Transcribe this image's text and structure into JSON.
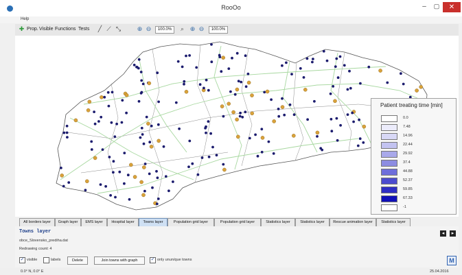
{
  "window": {
    "title": "RooOo"
  },
  "menu": {
    "help": "Help"
  },
  "toolbar": {
    "prop": "Prop.",
    "visible": "Visible",
    "functions": "Functions",
    "tests": "Tests",
    "zoom1": "100.0%",
    "zoom2": "100.0%"
  },
  "legend": {
    "title": "Patient treating time [min]",
    "items": [
      {
        "label": "0.0",
        "color": "#ffffff"
      },
      {
        "label": "7.48",
        "color": "#ececfb"
      },
      {
        "label": "14.96",
        "color": "#d8d8f6"
      },
      {
        "label": "22.44",
        "color": "#c3c3f1"
      },
      {
        "label": "29.92",
        "color": "#a9a9ea"
      },
      {
        "label": "37.4",
        "color": "#8d8de2"
      },
      {
        "label": "44.88",
        "color": "#6e6edb"
      },
      {
        "label": "52.37",
        "color": "#4c4ccf"
      },
      {
        "label": "59.85",
        "color": "#2e2ec4"
      },
      {
        "label": "67.33",
        "color": "#1010b8"
      },
      {
        "label": "-1",
        "color": "#ffffff"
      }
    ]
  },
  "tabs": [
    {
      "label": "All borders layer",
      "active": false
    },
    {
      "label": "Graph layer",
      "active": false
    },
    {
      "label": "EMS layer",
      "active": false
    },
    {
      "label": "Hospital layer",
      "active": false
    },
    {
      "label": "Towns layer",
      "active": true
    },
    {
      "label": "Population grid layer",
      "active": false
    },
    {
      "label": "Population grid layer",
      "active": false
    },
    {
      "label": "Statistics layer",
      "active": false
    },
    {
      "label": "Statistics layer",
      "active": false
    },
    {
      "label": "Rescue animation layer",
      "active": false
    },
    {
      "label": "Statistics layer",
      "active": false
    }
  ],
  "panel": {
    "title": "Towns layer",
    "file": "obce_Slovensko_prediha.dat",
    "redrawing": "Redrawing count: 4",
    "visible_label": "visible",
    "visible_checked": true,
    "labels_label": "labels",
    "labels_checked": false,
    "delete_label": "Delete",
    "join_label": "Join towns with graph",
    "unique_label": "only unun/que towns",
    "unique_checked": true
  },
  "status": {
    "coords": "0.0° N, 0.0° E",
    "date": "25.04.2016"
  },
  "colors": {
    "town_dot": "#1c1c6e",
    "hospital": "#d9a23a",
    "road": "#a8d8a0",
    "border": "#555555",
    "active_tab": "#cfe0f3"
  }
}
